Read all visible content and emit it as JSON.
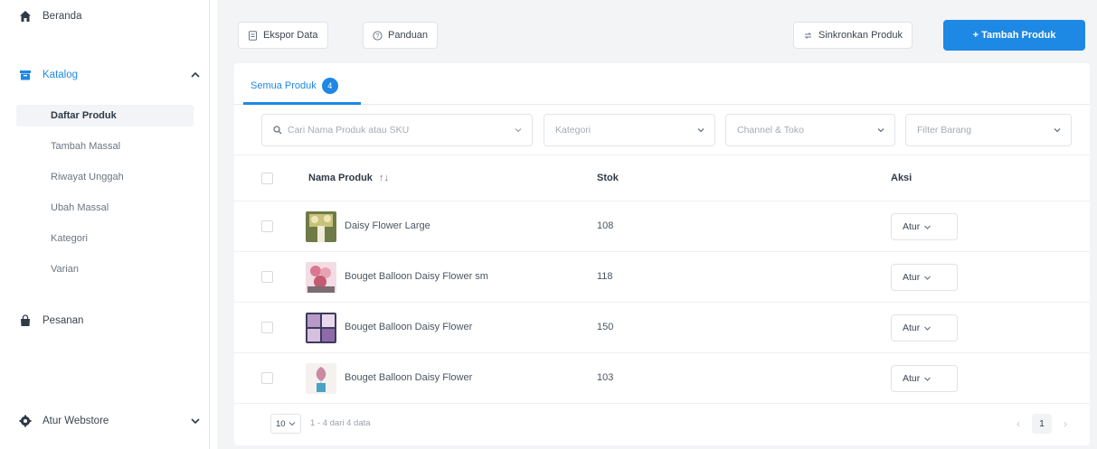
{
  "sidebar": {
    "home": {
      "label": "Beranda",
      "icon": "home-icon"
    },
    "catalog": {
      "label": "Katalog",
      "icon": "catalog-icon",
      "expanded": true,
      "items": [
        {
          "label": "Daftar Produk",
          "active": true
        },
        {
          "label": "Tambah Massal",
          "active": false
        },
        {
          "label": "Riwayat Unggah",
          "active": false
        },
        {
          "label": "Ubah Massal",
          "active": false
        },
        {
          "label": "Kategori",
          "active": false
        },
        {
          "label": "Varian",
          "active": false
        }
      ]
    },
    "orders": {
      "label": "Pesanan",
      "icon": "bag-icon"
    },
    "webstore": {
      "label": "Atur Webstore",
      "icon": "gear-icon"
    }
  },
  "toolbar": {
    "export_label": "Ekspor Data",
    "guide_label": "Panduan",
    "sync_label": "Sinkronkan Produk",
    "add_label": "+ Tambah Produk"
  },
  "tabs": [
    {
      "label": "Semua Produk",
      "count": "4",
      "active": true
    }
  ],
  "filters": {
    "search_placeholder": "Cari Nama Produk atau SKU",
    "category_placeholder": "Kategori",
    "channel_placeholder": "Channel & Toko",
    "filter_placeholder": "Filter Barang"
  },
  "table": {
    "headers": {
      "name": "Nama Produk",
      "stock": "Stok",
      "action": "Aksi"
    },
    "rows": [
      {
        "name": "Daisy Flower Large",
        "stock": "108",
        "action": "Atur",
        "thumb": "thumb-1"
      },
      {
        "name": "Bouget Balloon Daisy Flower sm",
        "stock": "118",
        "action": "Atur",
        "thumb": "thumb-2"
      },
      {
        "name": "Bouget Balloon Daisy Flower",
        "stock": "150",
        "action": "Atur",
        "thumb": "thumb-3"
      },
      {
        "name": "Bouget Balloon Daisy Flower",
        "stock": "103",
        "action": "Atur",
        "thumb": "thumb-4"
      }
    ]
  },
  "pagination": {
    "page_size": "10",
    "range_text": "1 - 4 dari 4 data",
    "current_page": "1"
  },
  "colors": {
    "accent": "#1e88e5",
    "background": "#f3f4f6"
  }
}
